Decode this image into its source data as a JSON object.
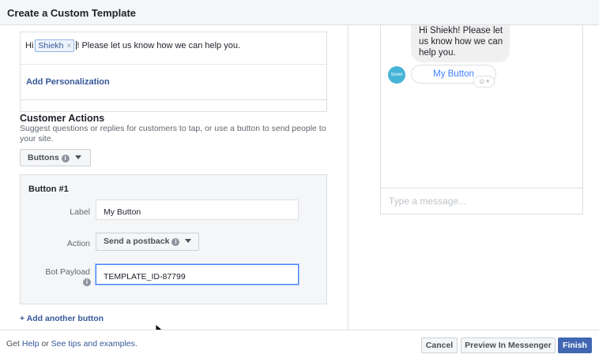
{
  "header": {
    "title": "Create a Custom Template"
  },
  "message": {
    "prefix": "Hi",
    "token_label": "Shiekh",
    "token_remove": "×",
    "suffix": "! Please let us know how we can help you.",
    "add_personalization": "Add Personalization"
  },
  "customer_actions": {
    "title": "Customer Actions",
    "description": "Suggest questions or replies for customers to tap, or use a button to send people to your site.",
    "type_select": "Buttons",
    "info_glyph": "i"
  },
  "button_card": {
    "title": "Button #1",
    "label_caption": "Label",
    "label_value": "My Button",
    "action_caption": "Action",
    "action_value": "Send a postback",
    "payload_caption": "Bot Payload",
    "payload_value": "TEMPLATE_ID-87799"
  },
  "add_another": "+ Add another button",
  "preview": {
    "bubble_text": "Hi Shiekh! Please let us know how we can help you.",
    "button_label": "My Button",
    "avatar_text": "Shiekh",
    "react_glyph": "☺+",
    "composer_placeholder": "Type a message..."
  },
  "footer": {
    "get": "Get",
    "help_link": "Help",
    "or": "or",
    "tips_link": "See tips and examples.",
    "cancel": "Cancel",
    "preview_in_messenger": "Preview In Messenger",
    "finish": "Finish"
  },
  "colors": {
    "accent": "#4267b2",
    "link": "#365899",
    "focus": "#4080ff",
    "avatar": "#46b4d6"
  },
  "icons": [
    "info-icon",
    "dropdown-arrow-icon",
    "remove-token-icon",
    "mouse-cursor-icon",
    "reaction-icon"
  ]
}
